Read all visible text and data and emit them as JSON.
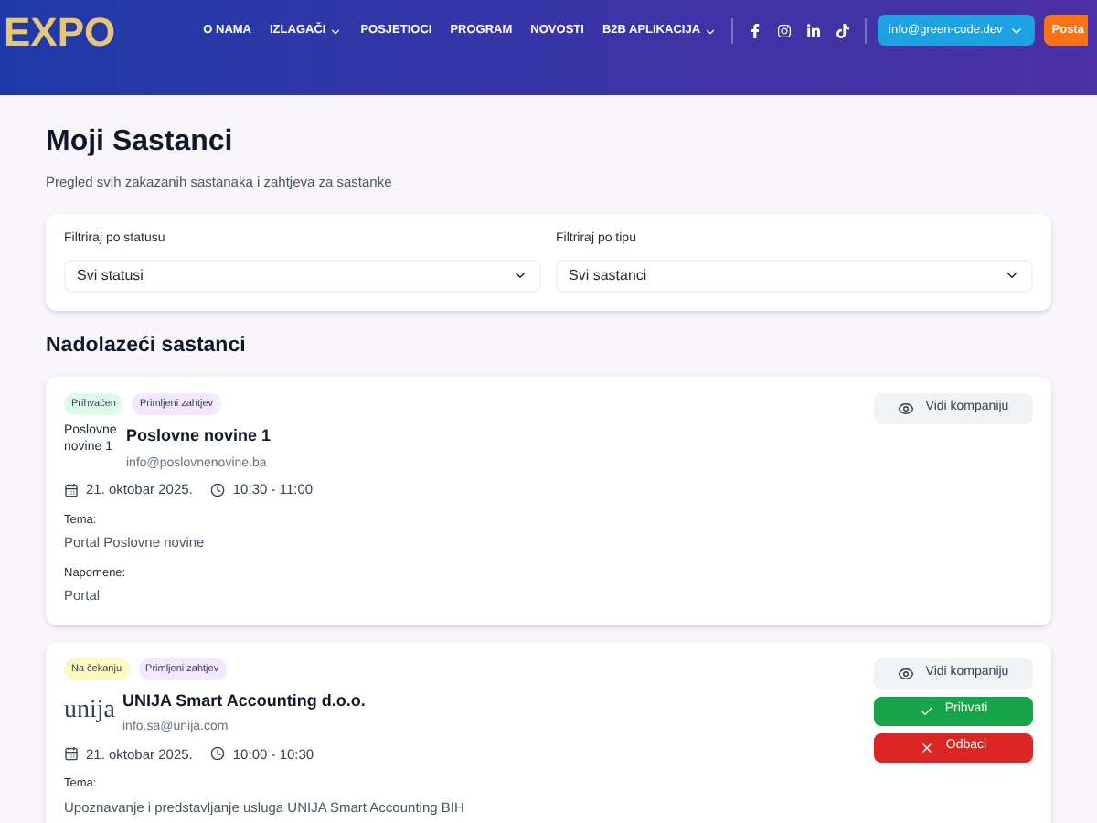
{
  "header": {
    "logo": "EXPO",
    "nav": [
      {
        "label": "O NAMA",
        "dropdown": false
      },
      {
        "label": "IZLAGAČI",
        "dropdown": true
      },
      {
        "label": "POSJETIOCI",
        "dropdown": false
      },
      {
        "label": "PROGRAM",
        "dropdown": false
      },
      {
        "label": "NOVOSTI",
        "dropdown": false
      },
      {
        "label": "B2B APLIKACIJA",
        "dropdown": true
      }
    ],
    "social": [
      {
        "kind": "facebook"
      },
      {
        "kind": "instagram"
      },
      {
        "kind": "linkedin"
      },
      {
        "kind": "tiktok"
      }
    ],
    "account": "info@green-code.dev",
    "cta": "Posta"
  },
  "page": {
    "title": "Moji Sastanci",
    "subtitle": "Pregled svih zakazanih sastanaka i zahtjeva za sastanke"
  },
  "filters": [
    {
      "label": "Filtriraj po statusu",
      "value": "Svi statusi"
    },
    {
      "label": "Filtriraj po tipu",
      "value": "Svi sastanci"
    }
  ],
  "section_title": "Nadolazeći sastanci",
  "meetings": [
    {
      "badges": [
        {
          "label": "Prihvaćen",
          "color": "#dcfce7"
        },
        {
          "label": "Primljeni zahtjev",
          "color": "#f3e8ff"
        }
      ],
      "logo": {
        "kind": "alt",
        "text": "Poslovne novine 1"
      },
      "company": "Poslovne novine 1",
      "email": "info@poslovnenovine.ba",
      "date": "21. oktobar 2025.",
      "time": "10:30 - 11:00",
      "fields": [
        {
          "label": "Tema:",
          "value": "Portal Poslovne novine"
        },
        {
          "label": "Napomene:",
          "value": "Portal"
        }
      ],
      "actions": [
        {
          "kind": "view",
          "label": "Vidi kompaniju"
        }
      ]
    },
    {
      "badges": [
        {
          "label": "Na čekanju",
          "color": "#fef9c3"
        },
        {
          "label": "Primljeni zahtjev",
          "color": "#f3e8ff"
        }
      ],
      "logo": {
        "kind": "wordmark",
        "text": "unija"
      },
      "company": "UNIJA Smart Accounting d.o.o.",
      "email": "info.sa@unija.com",
      "date": "21. oktobar 2025.",
      "time": "10:00 - 10:30",
      "fields": [
        {
          "label": "Tema:",
          "value": "Upoznavanje i predstavljanje usluga UNIJA Smart Accounting BIH"
        }
      ],
      "actions": [
        {
          "kind": "view",
          "label": "Vidi kompaniju"
        },
        {
          "kind": "accept",
          "label": "Prihvati"
        },
        {
          "kind": "reject",
          "label": "Odbaci"
        }
      ]
    }
  ]
}
